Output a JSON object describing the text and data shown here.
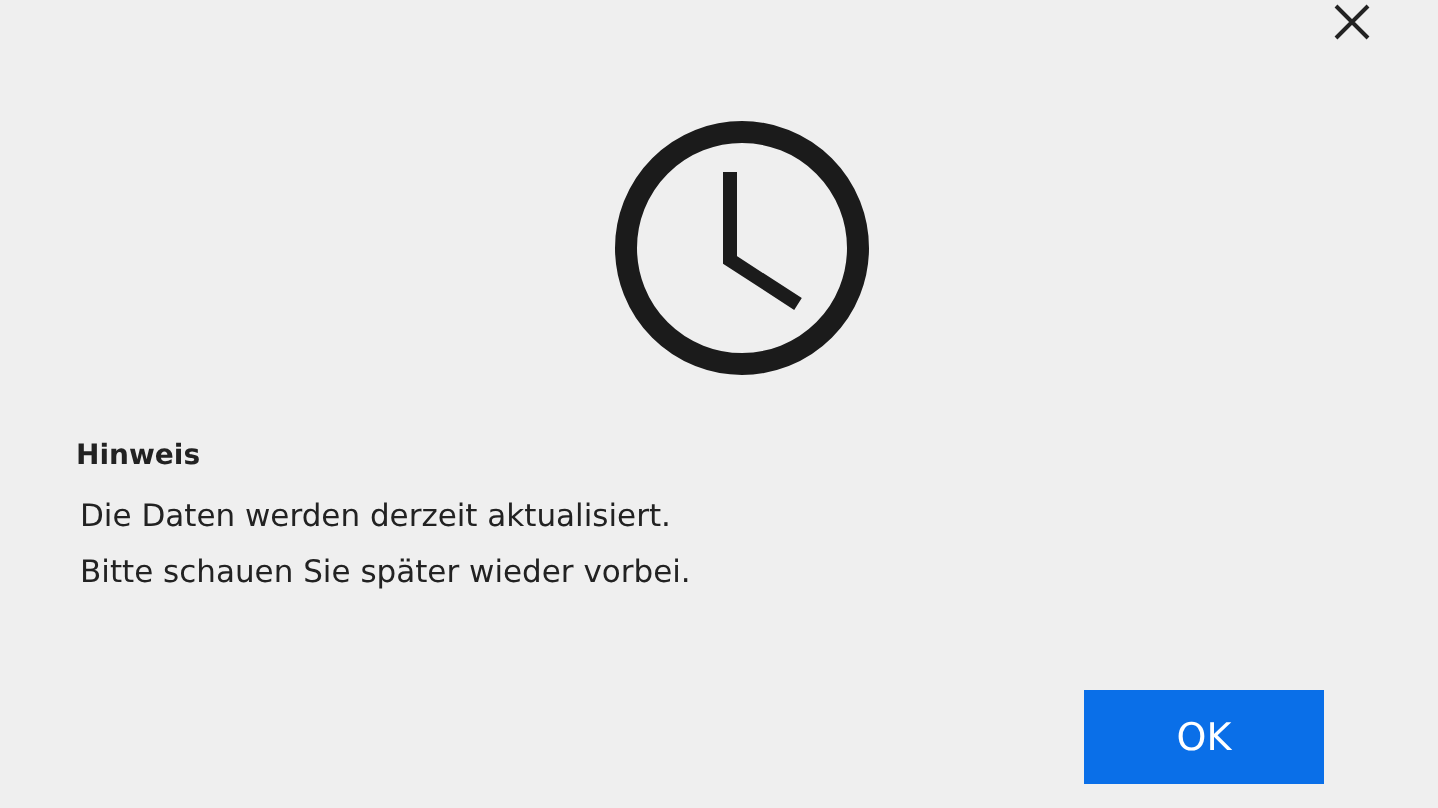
{
  "dialog": {
    "heading": "Hinweis",
    "message": [
      "Die Daten werden derzeit aktualisiert.",
      "Bitte schauen Sie später wieder vorbei."
    ],
    "buttons": [
      {
        "label": "OK",
        "kind": "primary"
      }
    ]
  }
}
